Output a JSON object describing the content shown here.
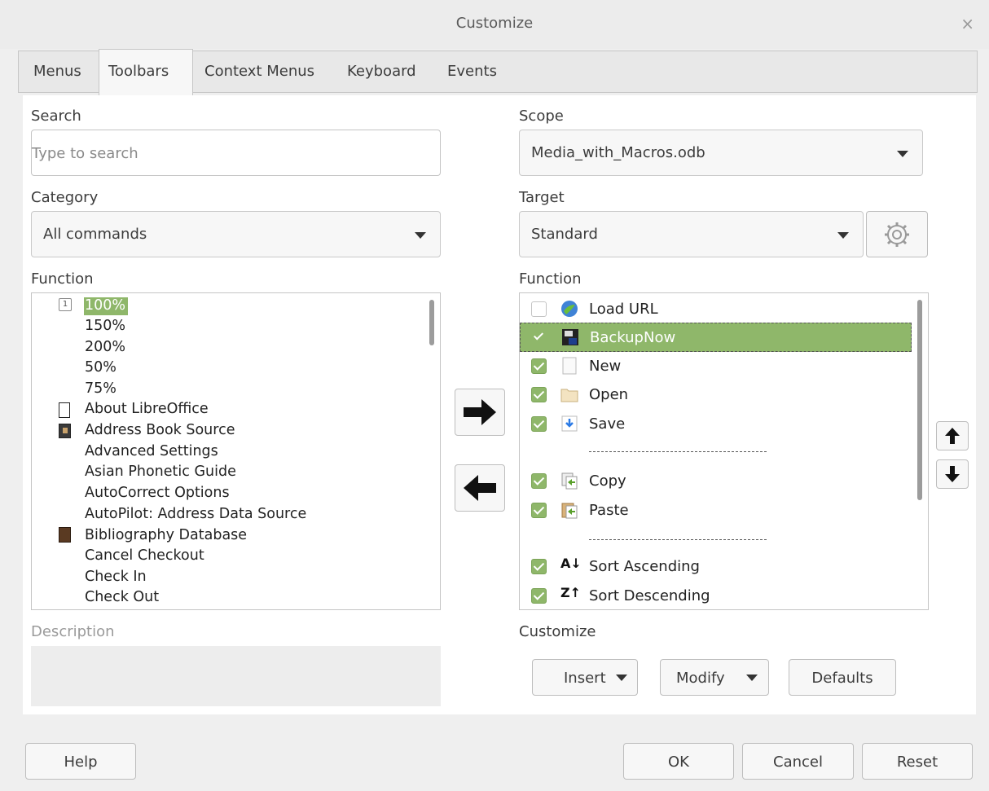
{
  "window": {
    "title": "Customize",
    "close_glyph": "×"
  },
  "tabs": [
    {
      "label": "Menus"
    },
    {
      "label": "Toolbars",
      "active": true
    },
    {
      "label": "Context Menus"
    },
    {
      "label": "Keyboard"
    },
    {
      "label": "Events"
    }
  ],
  "left": {
    "search_label": "Search",
    "search_placeholder": "Type to search",
    "category_label": "Category",
    "category_value": "All commands",
    "function_label": "Function",
    "functions": [
      "100%",
      "150%",
      "200%",
      "50%",
      "75%",
      "About LibreOffice",
      "Address Book Source",
      "Advanced Settings",
      "Asian Phonetic Guide",
      "AutoCorrect Options",
      "AutoPilot: Address Data Source",
      "Bibliography Database",
      "Cancel Checkout",
      "Check In",
      "Check Out"
    ],
    "description_label": "Description"
  },
  "right": {
    "scope_label": "Scope",
    "scope_value": "Media_with_Macros.odb",
    "target_label": "Target",
    "target_value": "Standard",
    "function_label": "Function",
    "entries": [
      {
        "label": "Load URL",
        "checked": false,
        "icon": "globe-icon"
      },
      {
        "label": "BackupNow",
        "checked": true,
        "icon": "backup-icon",
        "selected": true
      },
      {
        "label": "New",
        "checked": true,
        "icon": "new-doc-icon"
      },
      {
        "label": "Open",
        "checked": true,
        "icon": "folder-icon"
      },
      {
        "label": "Save",
        "checked": true,
        "icon": "save-icon"
      },
      {
        "separator": true
      },
      {
        "label": "Copy",
        "checked": true,
        "icon": "copy-icon"
      },
      {
        "label": "Paste",
        "checked": true,
        "icon": "paste-icon"
      },
      {
        "separator": true
      },
      {
        "label": "Sort Ascending",
        "checked": true,
        "icon": "sort-ascending-icon"
      },
      {
        "label": "Sort Descending",
        "checked": true,
        "icon": "sort-descending-icon"
      }
    ],
    "customize_label": "Customize",
    "insert_label": "Insert",
    "modify_label": "Modify",
    "defaults_label": "Defaults"
  },
  "footer": {
    "help": "Help",
    "ok": "OK",
    "cancel": "Cancel",
    "reset": "Reset"
  },
  "colors": {
    "selection": "#8fb76a",
    "check": "#8fb76a"
  }
}
